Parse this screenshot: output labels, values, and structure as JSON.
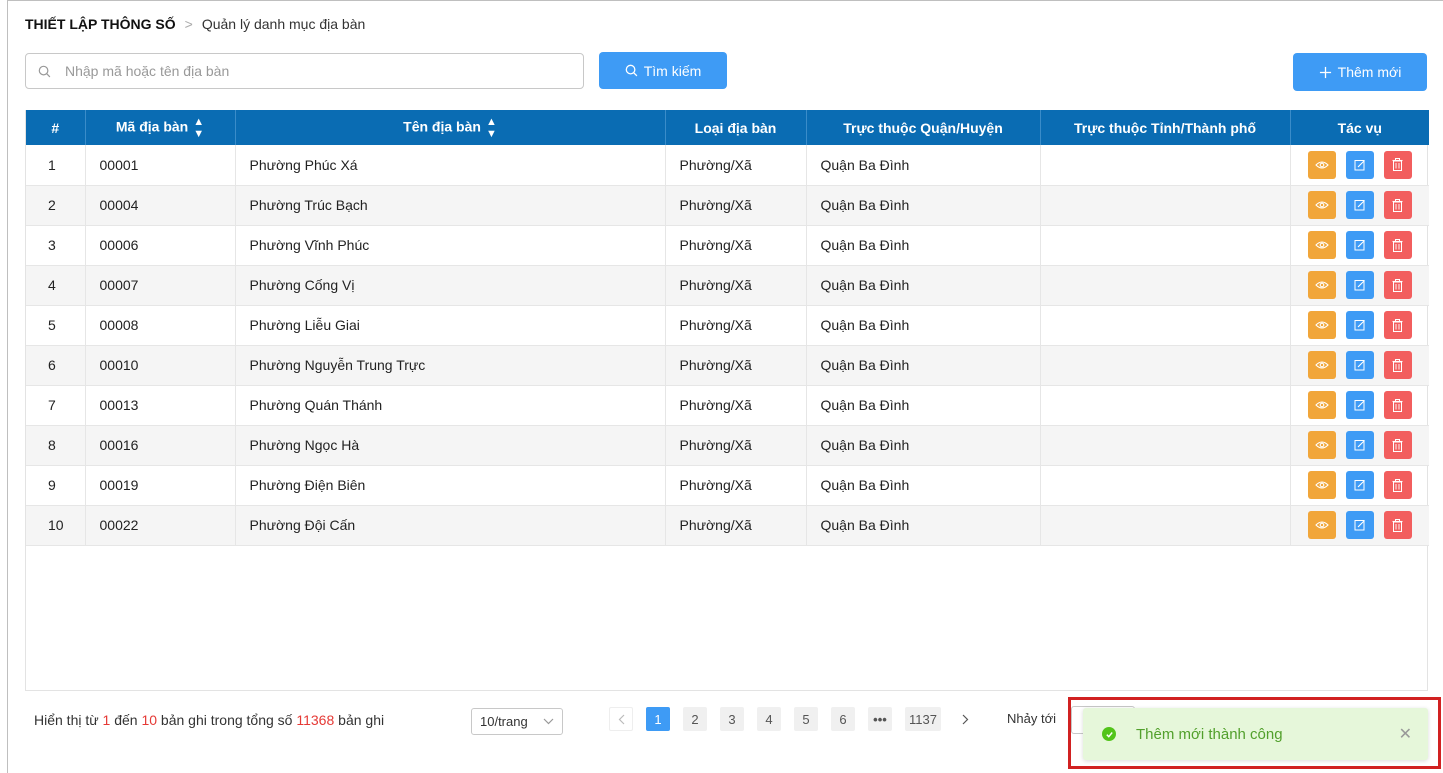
{
  "breadcrumb": {
    "root": "THIẾT LẬP THÔNG SỐ",
    "separator": ">",
    "current": "Quản lý danh mục địa bàn"
  },
  "search": {
    "placeholder": "Nhập mã hoặc tên địa bàn",
    "value": "",
    "button_label": "Tìm kiếm",
    "icon": "search-icon"
  },
  "add_button": {
    "label": "Thêm mới",
    "icon": "plus-icon"
  },
  "table": {
    "columns": [
      "#",
      "Mã địa bàn",
      "Tên địa bàn",
      "Loại địa bàn",
      "Trực thuộc Quận/Huyện",
      "Trực thuộc Tỉnh/Thành phố",
      "Tác vụ"
    ],
    "sortable_columns": [
      1,
      2
    ],
    "rows": [
      {
        "index": "1",
        "code": "00001",
        "name": "Phường Phúc Xá",
        "type": "Phường/Xã",
        "district": "Quận Ba Đình",
        "province": ""
      },
      {
        "index": "2",
        "code": "00004",
        "name": "Phường Trúc Bạch",
        "type": "Phường/Xã",
        "district": "Quận Ba Đình",
        "province": ""
      },
      {
        "index": "3",
        "code": "00006",
        "name": "Phường Vĩnh Phúc",
        "type": "Phường/Xã",
        "district": "Quận Ba Đình",
        "province": ""
      },
      {
        "index": "4",
        "code": "00007",
        "name": "Phường Cống Vị",
        "type": "Phường/Xã",
        "district": "Quận Ba Đình",
        "province": ""
      },
      {
        "index": "5",
        "code": "00008",
        "name": "Phường Liễu Giai",
        "type": "Phường/Xã",
        "district": "Quận Ba Đình",
        "province": ""
      },
      {
        "index": "6",
        "code": "00010",
        "name": "Phường Nguyễn Trung Trực",
        "type": "Phường/Xã",
        "district": "Quận Ba Đình",
        "province": ""
      },
      {
        "index": "7",
        "code": "00013",
        "name": "Phường Quán Thánh",
        "type": "Phường/Xã",
        "district": "Quận Ba Đình",
        "province": ""
      },
      {
        "index": "8",
        "code": "00016",
        "name": "Phường Ngọc Hà",
        "type": "Phường/Xã",
        "district": "Quận Ba Đình",
        "province": ""
      },
      {
        "index": "9",
        "code": "00019",
        "name": "Phường Điện Biên",
        "type": "Phường/Xã",
        "district": "Quận Ba Đình",
        "province": ""
      },
      {
        "index": "10",
        "code": "00022",
        "name": "Phường Đội Cấn",
        "type": "Phường/Xã",
        "district": "Quận Ba Đình",
        "province": ""
      }
    ],
    "action_icons": [
      "eye-icon",
      "edit-icon",
      "trash-icon"
    ]
  },
  "footer": {
    "prefix": "Hiển thị từ",
    "from": "1",
    "between": "đến",
    "to": "10",
    "middle": "bản ghi trong tổng số",
    "total": "11368",
    "suffix": "bản ghi",
    "page_size": "10/trang",
    "pages": [
      "1",
      "2",
      "3",
      "4",
      "5",
      "6",
      "•••",
      "1137"
    ],
    "current_page": "1",
    "jump_label": "Nhảy tới",
    "jump_value": ""
  },
  "toast": {
    "message": "Thêm mới thành công",
    "close_symbol": "✕",
    "status_color": "#52c41a"
  },
  "colors": {
    "header_bg": "#0a6cb3",
    "primary": "#3e9bf5",
    "view_button": "#f1a63a",
    "delete_button": "#f25e5e",
    "highlight_outline": "#d12121"
  }
}
